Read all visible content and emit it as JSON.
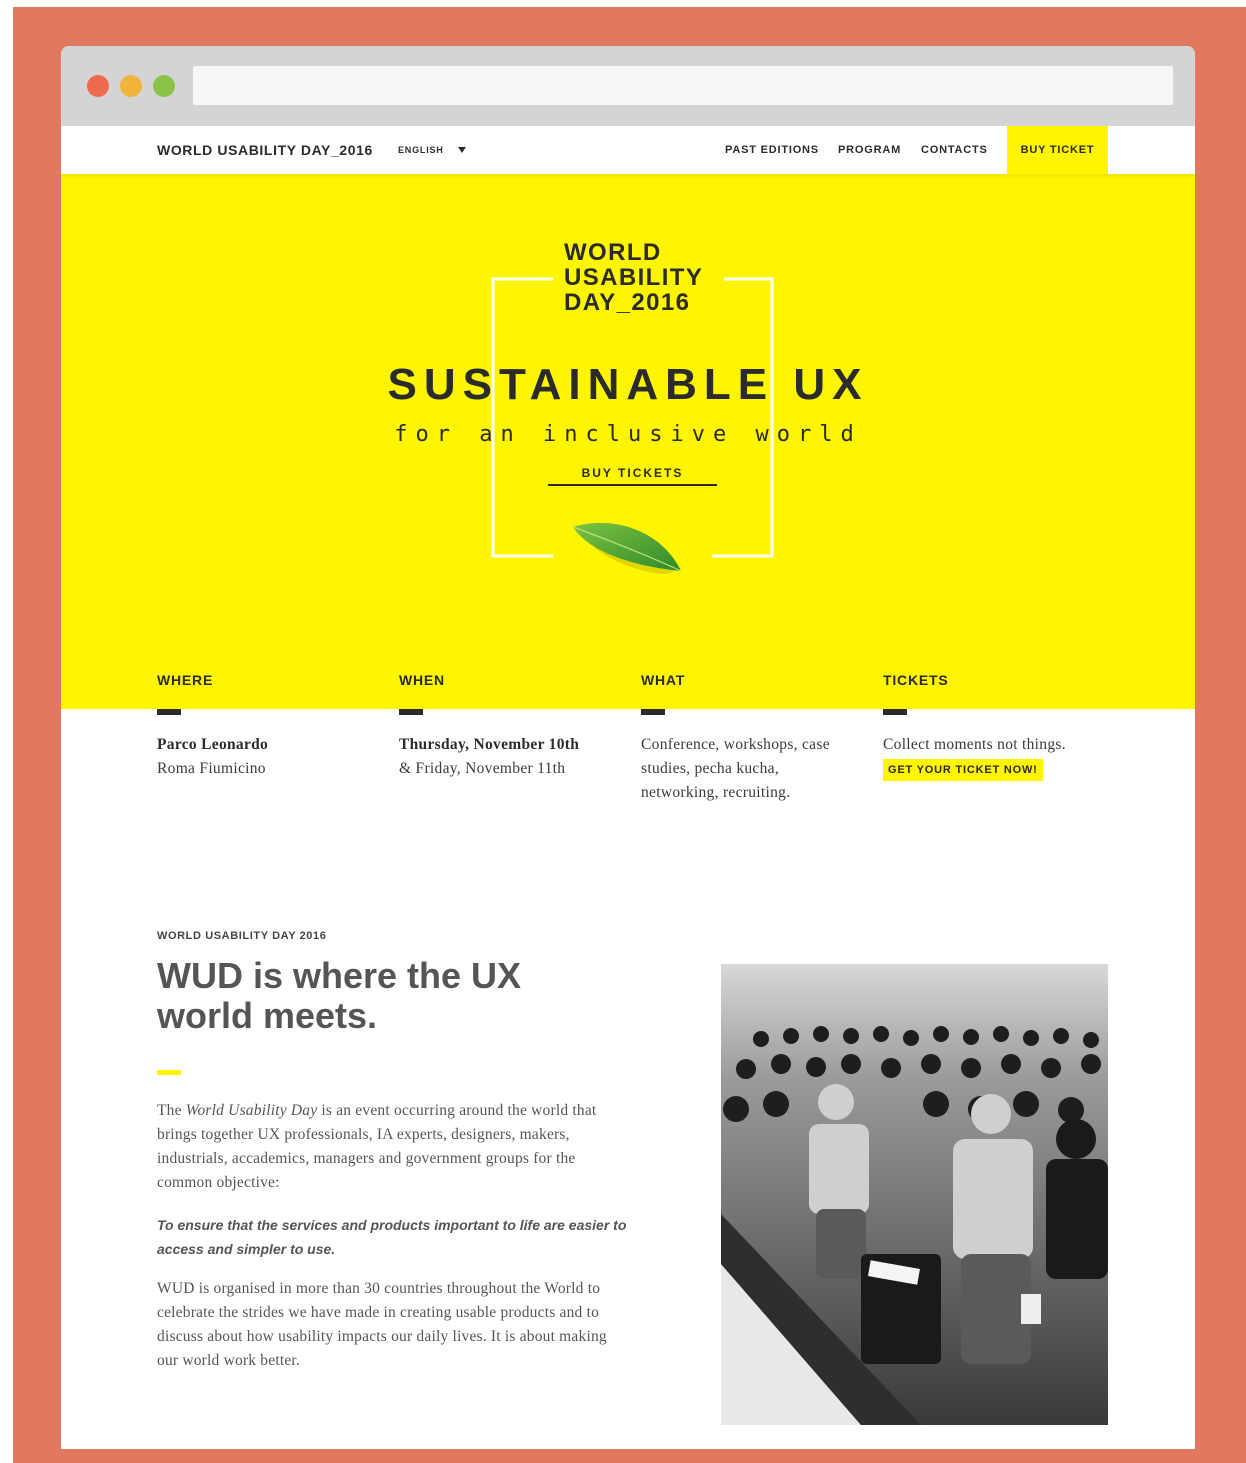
{
  "nav": {
    "brand": "WORLD USABILITY DAY_2016",
    "language": "ENGLISH",
    "links": [
      "PAST EDITIONS",
      "PROGRAM",
      "CONTACTS"
    ],
    "buy_ticket": "BUY TICKET"
  },
  "hero": {
    "logo_line1": "WORLD",
    "logo_line2": "USABILITY",
    "logo_line3": "DAY_2016",
    "title": "SUSTAINABLE UX",
    "subtitle": "for an inclusive world",
    "cta": "BUY TICKETS"
  },
  "info": [
    {
      "heading": "WHERE",
      "line1": "Parco Leonardo",
      "line2": "Roma Fiumicino"
    },
    {
      "heading": "WHEN",
      "line1": "Thursday, November 10th",
      "line2": "& Friday, November 11th"
    },
    {
      "heading": "WHAT",
      "line1": "Conference, workshops, case",
      "line2": "studies, pecha kucha,",
      "line3": "networking, recruiting."
    },
    {
      "heading": "TICKETS",
      "line1": "Collect moments not things.",
      "tag": "GET YOUR TICKET NOW!"
    }
  ],
  "about": {
    "eyebrow": "WORLD USABILITY DAY 2016",
    "title": "WUD is where the UX world meets.",
    "para1_pre": "The ",
    "para1_em": "World Usability Day",
    "para1_post": " is an event occurring around the world that brings together UX professionals, IA experts, designers, makers, industrials, accademics, managers and government groups for the common objective:",
    "quote": "To ensure that the services and products important to life are easier to access and simpler to use.",
    "para2": "WUD is organised in more than 30 countries throughout the World to celebrate the strides we have made in creating usable products and to discuss about how usability impacts our daily lives. It is about making our world work better."
  },
  "colors": {
    "frame": "#e27860",
    "accent_yellow": "#fff500",
    "text_dark": "#2b2b2b"
  }
}
